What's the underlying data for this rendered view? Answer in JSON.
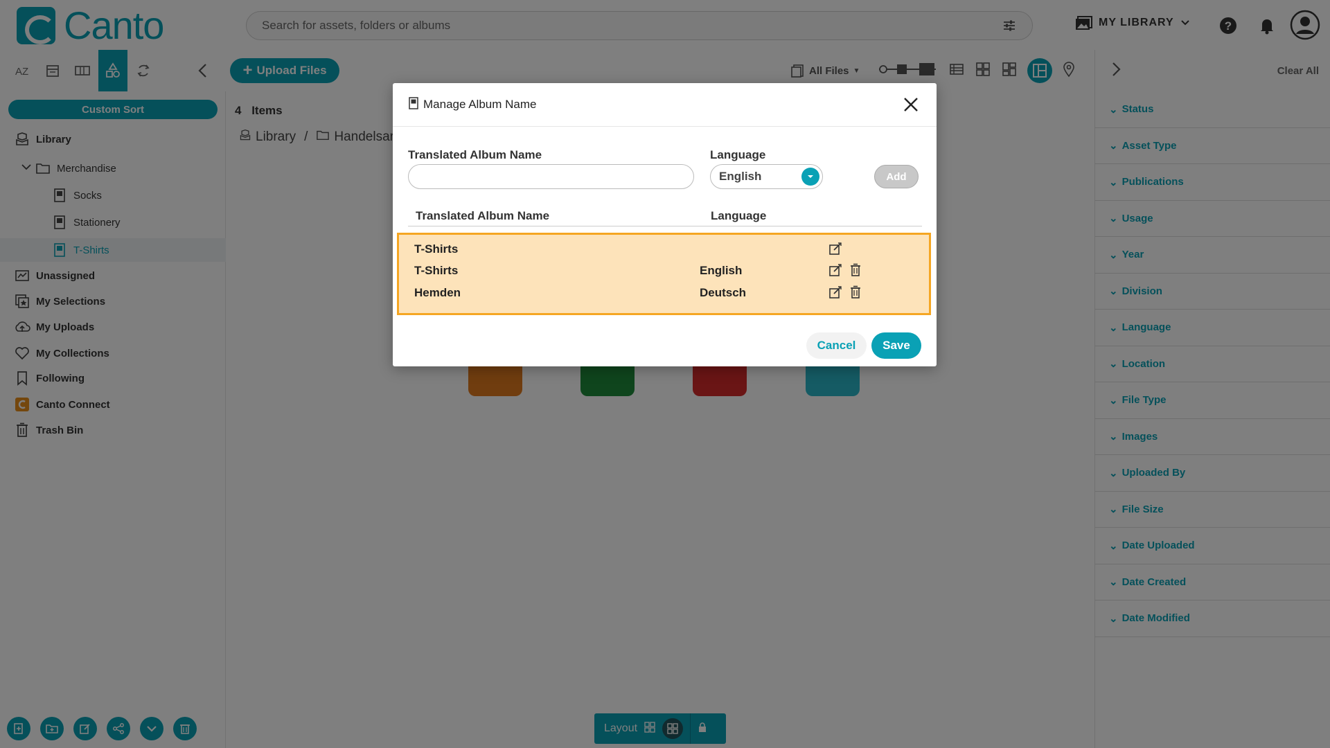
{
  "app": {
    "logo_text": "Canto"
  },
  "search": {
    "placeholder": "Search for assets, folders or albums"
  },
  "header": {
    "library_label": "MY LIBRARY"
  },
  "toolbar": {
    "upload_label": "Upload Files",
    "all_files_label": "All Files"
  },
  "sidebar": {
    "custom_sort_label": "Custom Sort",
    "items": [
      {
        "label": "Library",
        "icon": "library-icon"
      },
      {
        "label": "Merchandise",
        "icon": "folder-icon"
      },
      {
        "label": "Socks",
        "icon": "album-icon"
      },
      {
        "label": "Stationery",
        "icon": "album-icon"
      },
      {
        "label": "T-Shirts",
        "icon": "album-icon"
      },
      {
        "label": "Unassigned",
        "icon": "unassigned-icon"
      },
      {
        "label": "My Selections",
        "icon": "selections-icon"
      },
      {
        "label": "My Uploads",
        "icon": "upload-cloud-icon"
      },
      {
        "label": "My Collections",
        "icon": "heart-icon"
      },
      {
        "label": "Following",
        "icon": "bookmark-icon"
      },
      {
        "label": "Canto Connect",
        "icon": "canto-connect-icon"
      },
      {
        "label": "Trash Bin",
        "icon": "trash-icon"
      }
    ]
  },
  "main": {
    "items_count": "4",
    "items_label": "Items",
    "breadcrumb": [
      "Library",
      "Handelsartikel"
    ],
    "layout_label": "Layout"
  },
  "filters": {
    "clear_all_label": "Clear All",
    "items": [
      "Status",
      "Asset Type",
      "Publications",
      "Usage",
      "Year",
      "Division",
      "Language",
      "Location",
      "File Type",
      "Images",
      "Uploaded By",
      "File Size",
      "Date Uploaded",
      "Date Created",
      "Date Modified"
    ]
  },
  "modal": {
    "title": "Manage Album Name",
    "input_label": "Translated Album Name",
    "language_label": "Language",
    "selected_language": "English",
    "add_label": "Add",
    "col_name": "Translated Album Name",
    "col_language": "Language",
    "rows": [
      {
        "name": "T-Shirts",
        "language": ""
      },
      {
        "name": "T-Shirts",
        "language": "English"
      },
      {
        "name": "Hemden",
        "language": "Deutsch"
      }
    ],
    "cancel_label": "Cancel",
    "save_label": "Save"
  },
  "colors": {
    "accent": "#0aa1b5",
    "highlight_border": "#f5a623",
    "highlight_fill": "#fde3ba"
  }
}
